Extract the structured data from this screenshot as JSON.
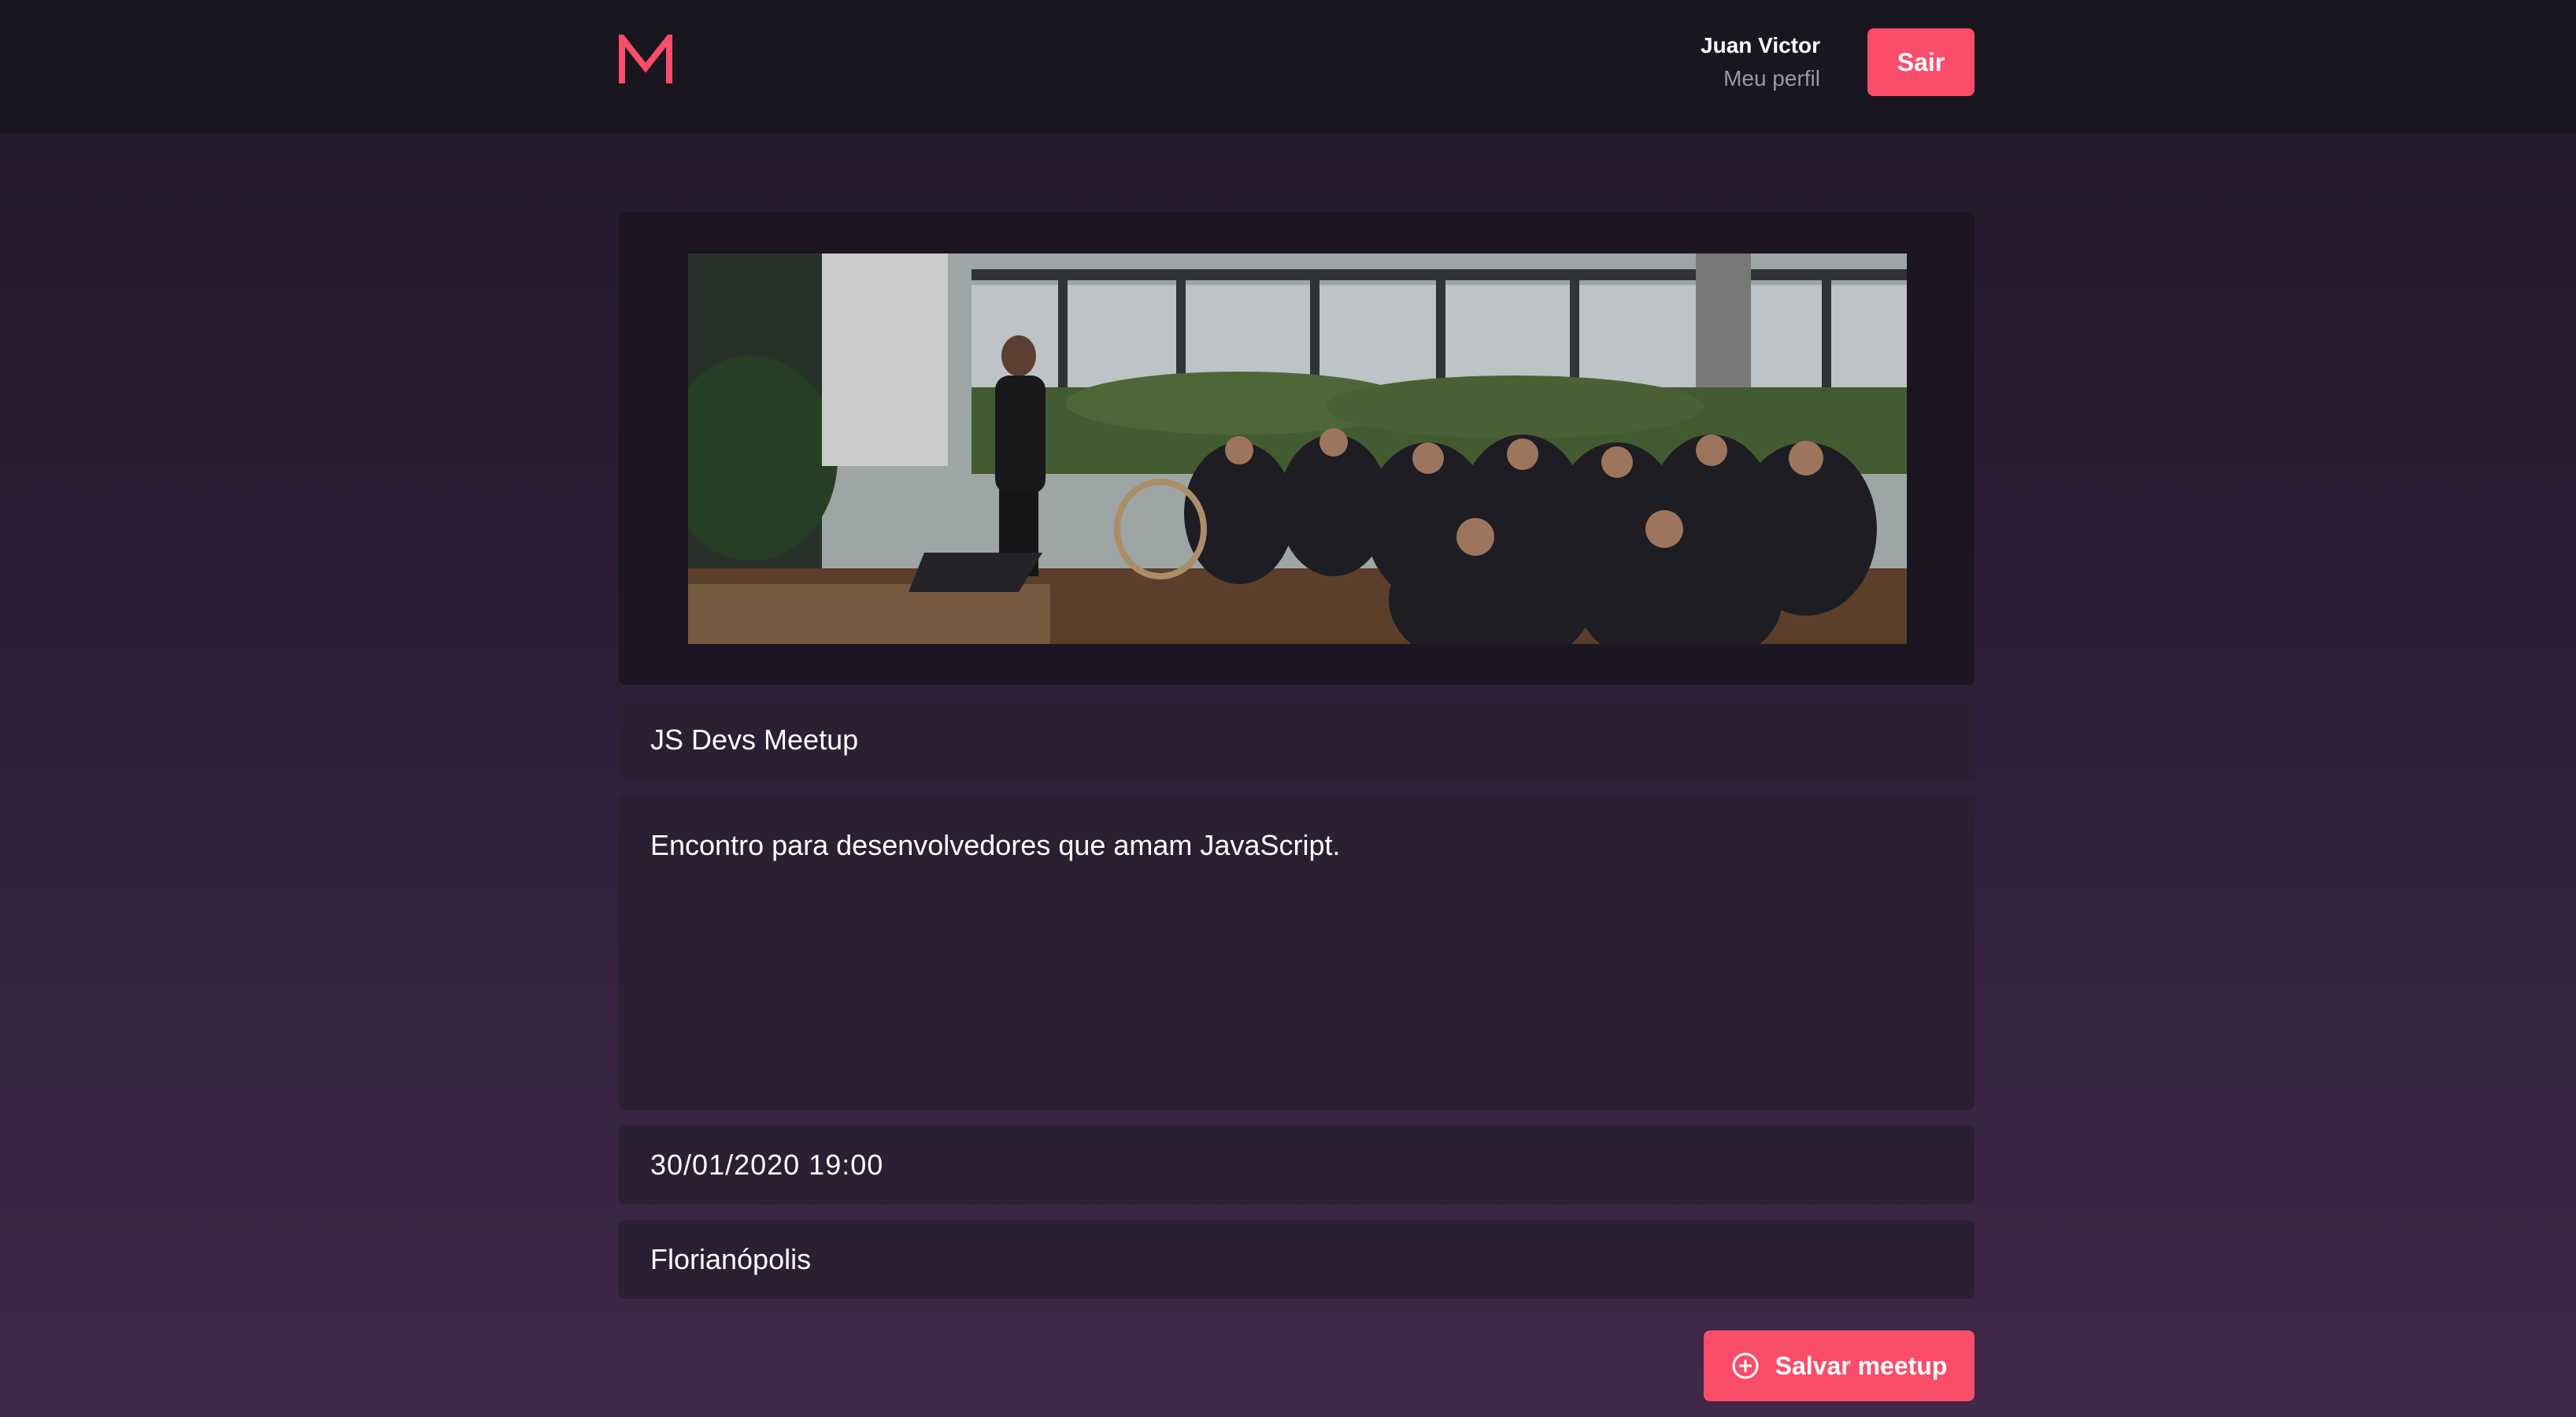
{
  "header": {
    "logo_text": "M",
    "user_name": "Juan Victor",
    "profile_link": "Meu perfil",
    "logout_label": "Sair"
  },
  "form": {
    "banner_alt": "Meetup banner",
    "title_value": "JS Devs Meetup",
    "description_value": "Encontro para desenvolvedores que amam JavaScript.",
    "date_value": "30/01/2020 19:00",
    "location_value": "Florianópolis",
    "save_label": "Salvar meetup",
    "save_icon": "add-circle-icon"
  },
  "colors": {
    "accent": "#f94d6a",
    "header_bg": "#19161f",
    "field_bg": "#2a1f33"
  }
}
